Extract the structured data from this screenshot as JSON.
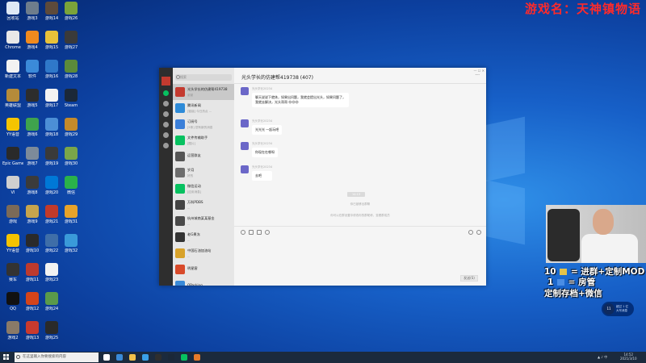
{
  "game_title": "游戏名：天神镇物语",
  "desktop": {
    "icons": [
      {
        "label": "回收站",
        "color": "#dfe9f5"
      },
      {
        "label": "Chrome",
        "color": "#e8e8e8"
      },
      {
        "label": "新建文本",
        "color": "#f2f2f2"
      },
      {
        "label": "英雄联盟",
        "color": "#b58b3a"
      },
      {
        "label": "YY语音",
        "color": "#f5c400"
      },
      {
        "label": "Epic Games",
        "color": "#2a2a2a"
      },
      {
        "label": "VI",
        "color": "#cfcfcf"
      },
      {
        "label": "游戏",
        "color": "#7b6a58"
      },
      {
        "label": "YY语音",
        "color": "#f5c400"
      },
      {
        "label": "赛车",
        "color": "#333333"
      },
      {
        "label": "QQ",
        "color": "#111111"
      },
      {
        "label": "游戏2",
        "color": "#8a7a68"
      },
      {
        "label": "游戏3",
        "color": "#6e7d8c"
      },
      {
        "label": "游戏4",
        "color": "#f08a1e"
      },
      {
        "label": "软件",
        "color": "#3b8ad9"
      },
      {
        "label": "游戏5",
        "color": "#2d2d2d"
      },
      {
        "label": "游戏6",
        "color": "#3fa34d"
      },
      {
        "label": "游戏7",
        "color": "#7d8b9a"
      },
      {
        "label": "游戏8",
        "color": "#3b3b3b"
      },
      {
        "label": "游戏9",
        "color": "#c6a44d"
      },
      {
        "label": "游戏10",
        "color": "#2a2a2a"
      },
      {
        "label": "游戏11",
        "color": "#bd3a2e"
      },
      {
        "label": "游戏12",
        "color": "#d4441a"
      },
      {
        "label": "游戏13",
        "color": "#c93a2e"
      },
      {
        "label": "游戏14",
        "color": "#5d4a3b"
      },
      {
        "label": "游戏15",
        "color": "#e8c23a"
      },
      {
        "label": "游戏16",
        "color": "#2f78c9"
      },
      {
        "label": "游戏17",
        "color": "#f2f2f2"
      },
      {
        "label": "游戏18",
        "color": "#4c8fd6"
      },
      {
        "label": "游戏19",
        "color": "#3a3a3a"
      },
      {
        "label": "游戏20",
        "color": "#0078d7"
      },
      {
        "label": "游戏21",
        "color": "#c23a2a"
      },
      {
        "label": "游戏22",
        "color": "#3f6ea8"
      },
      {
        "label": "游戏23",
        "color": "#f2f2f2"
      },
      {
        "label": "游戏24",
        "color": "#5a9a4a"
      },
      {
        "label": "游戏25",
        "color": "#2a2a2a"
      },
      {
        "label": "游戏26",
        "color": "#7aa33a"
      },
      {
        "label": "游戏27",
        "color": "#3a3a3a"
      },
      {
        "label": "游戏28",
        "color": "#5b8a3a"
      },
      {
        "label": "Steam",
        "color": "#1b2838"
      },
      {
        "label": "游戏29",
        "color": "#c48a2a"
      },
      {
        "label": "游戏30",
        "color": "#7aa64a"
      },
      {
        "label": "微信",
        "color": "#2ab24a"
      },
      {
        "label": "游戏31",
        "color": "#e8a32a"
      },
      {
        "label": "游戏32",
        "color": "#3a9ad9"
      }
    ]
  },
  "wechat": {
    "title": "光头学长的仿建帮419738 (407)",
    "search_placeholder": "搜索",
    "contacts": [
      {
        "name": "光头学长的仿建帮419738",
        "preview": "谢谢",
        "time": "",
        "color": "#c43a2f"
      },
      {
        "name": "腾讯新闻",
        "preview": "[链接] 今日热点 ...",
        "time": "",
        "color": "#2e8bd8"
      },
      {
        "name": "订阅号",
        "preview": "[5条] 您有新的消息",
        "time": "",
        "color": "#3b7fd9"
      },
      {
        "name": "文件传输助手",
        "preview": "[图片]",
        "time": "",
        "color": "#07c160"
      },
      {
        "name": "运营群友",
        "preview": "",
        "time": "",
        "color": "#555555"
      },
      {
        "name": "岁月",
        "preview": "好的",
        "time": "",
        "color": "#6d6d6d"
      },
      {
        "name": "微信运动",
        "preview": "[应用消息]",
        "time": "",
        "color": "#07c160"
      },
      {
        "name": "万科PDBS",
        "preview": "...",
        "time": "",
        "color": "#444444"
      },
      {
        "name": "杭州城南某某基金",
        "preview": "...",
        "time": "",
        "color": "#4a4a4a"
      },
      {
        "name": "老G果冻",
        "preview": "...",
        "time": "",
        "color": "#333333"
      },
      {
        "name": "中国石油加油站",
        "preview": "...",
        "time": "",
        "color": "#d8a22a"
      },
      {
        "name": "明星客",
        "preview": "",
        "time": "",
        "color": "#d84a2a"
      },
      {
        "name": "QParking",
        "preview": "",
        "time": "",
        "color": "#3a8ad8"
      }
    ],
    "messages": [
      {
        "sender": "光头学长20234",
        "text": "聊天说说下就休，如果出问题，我就会提出光头，如果问题了，我就去解决，光头哥哥",
        "emoji": "😄😄😄"
      },
      {
        "sender": "光头学长20234",
        "text": "光光光 一起玩吧"
      },
      {
        "sender": "光头学长20234",
        "text": "你现在在哪呀"
      },
      {
        "sender": "光头学长20234",
        "text": "去吧"
      }
    ],
    "system_time": "14:13",
    "system_notes": [
      "你已被移出群聊",
      "你可以在群设置中修改你的群昵称，查看群成员"
    ],
    "send_label": "发送(S)"
  },
  "stream_overlay": {
    "line1": "10",
    "line1_text": "= 进群+定制MOD",
    "line2": "1",
    "line2_text": "= 房管",
    "line3": "定制存档+微信"
  },
  "notification": {
    "circle": "11",
    "text1": "超过 1 亿",
    "text2": "大写消息"
  },
  "taskbar": {
    "search_placeholder": "在这里输入你要搜索的内容",
    "time": "14:52",
    "date": "2021/3/10"
  }
}
